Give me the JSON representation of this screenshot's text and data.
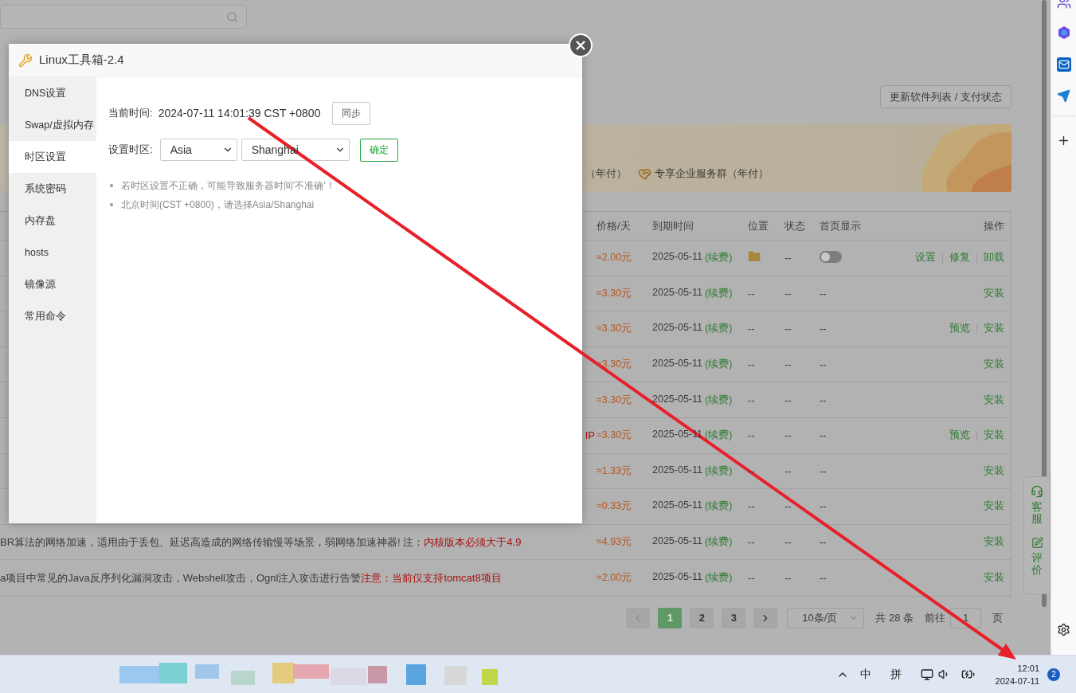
{
  "dialog": {
    "title": "Linux工具箱-2.4",
    "menu": [
      {
        "label": "DNS设置",
        "selected": false
      },
      {
        "label": "Swap/虚拟内存",
        "selected": false
      },
      {
        "label": "时区设置",
        "selected": true
      },
      {
        "label": "系统密码",
        "selected": false
      },
      {
        "label": "内存盘",
        "selected": false
      },
      {
        "label": "hosts",
        "selected": false
      },
      {
        "label": "镜像源",
        "selected": false
      },
      {
        "label": "常用命令",
        "selected": false
      }
    ],
    "time_label": "当前时间:",
    "time_value": "2024-07-11 14:01:39 CST +0800",
    "sync_button": "同步",
    "zone_label": "设置时区:",
    "region": "Asia",
    "city": "Shanghai",
    "confirm_button": "确定",
    "notes": [
      "若时区设置不正确，可能导致服务器时间'不准确'！",
      "北京时间(CST +0800)，请选择Asia/Shanghai"
    ]
  },
  "refresh_button": "更新软件列表 / 支付状态",
  "banner": {
    "items": [
      "（年付）",
      "专享企业服务群（年付）"
    ]
  },
  "table": {
    "columns": [
      "价格/天",
      "到期时间",
      "位置",
      "状态",
      "首页显示",
      "操作"
    ],
    "rows": [
      {
        "price": "≈2.00元",
        "expiry": "2025-05-11",
        "renew": "(续费)",
        "location": {
          "kind": "folder"
        },
        "status": "--",
        "homepage": {
          "kind": "toggle",
          "on": false
        },
        "actions": [
          "设置",
          "修复",
          "卸载"
        ]
      },
      {
        "price": "≈3.30元",
        "expiry": "2025-05-11",
        "renew": "(续费)",
        "location": {
          "kind": "text",
          "text": "--"
        },
        "status": "--",
        "homepage": {
          "kind": "text",
          "text": "--"
        },
        "actions": [
          "安装"
        ]
      },
      {
        "price": "≈3.30元",
        "expiry": "2025-05-11",
        "renew": "(续费)",
        "location": {
          "kind": "text",
          "text": "--"
        },
        "status": "--",
        "homepage": {
          "kind": "text",
          "text": "--"
        },
        "actions": [
          "预览",
          "安装"
        ]
      },
      {
        "price": "≈3.30元",
        "expiry": "2025-05-11",
        "renew": "(续费)",
        "location": {
          "kind": "text",
          "text": "--"
        },
        "status": "--",
        "homepage": {
          "kind": "text",
          "text": "--"
        },
        "actions": [
          "安装"
        ]
      },
      {
        "price": "≈3.30元",
        "expiry": "2025-05-11",
        "renew": "(续费)",
        "location": {
          "kind": "text",
          "text": "--"
        },
        "status": "--",
        "homepage": {
          "kind": "text",
          "text": "--"
        },
        "actions": [
          "安装"
        ]
      },
      {
        "description": {
          "warning": "IP"
        },
        "price": "≈3.30元",
        "expiry": "2025-05-11",
        "renew": "(续费)",
        "location": {
          "kind": "text",
          "text": "--"
        },
        "status": "--",
        "homepage": {
          "kind": "text",
          "text": "--"
        },
        "actions": [
          "预览",
          "安装"
        ]
      },
      {
        "price": "≈1.33元",
        "expiry": "2025-05-11",
        "renew": "(续费)",
        "location": {
          "kind": "text",
          "text": "--"
        },
        "status": "--",
        "homepage": {
          "kind": "text",
          "text": "--"
        },
        "actions": [
          "安装"
        ]
      },
      {
        "price": "≈0.33元",
        "expiry": "2025-05-11",
        "renew": "(续费)",
        "location": {
          "kind": "text",
          "text": "--"
        },
        "status": "--",
        "homepage": {
          "kind": "text",
          "text": "--"
        },
        "actions": [
          "安装"
        ]
      },
      {
        "description": {
          "text": "BR算法的网络加速，适用由于丢包、延迟高造成的网络传输慢等场景，弱网络加速神器! 注：",
          "warning": "内核版本必须大于4.9"
        },
        "price": "≈4.93元",
        "expiry": "2025-05-11",
        "renew": "(续费)",
        "location": {
          "kind": "text",
          "text": "--"
        },
        "status": "--",
        "homepage": {
          "kind": "text",
          "text": "--"
        },
        "actions": [
          "安装"
        ]
      },
      {
        "description": {
          "text": "a项目中常见的Java反序列化漏洞攻击，Webshell攻击，Ognl注入攻击进行告警",
          "warning": "注意：当前仅支持tomcat8项目"
        },
        "price": "≈2.00元",
        "expiry": "2025-05-11",
        "renew": "(续费)",
        "location": {
          "kind": "text",
          "text": "--"
        },
        "status": "--",
        "homepage": {
          "kind": "text",
          "text": "--"
        },
        "actions": [
          "安装"
        ]
      }
    ]
  },
  "pagination": {
    "pages": [
      {
        "label": "1",
        "selected": true
      },
      {
        "label": "2",
        "selected": false
      },
      {
        "label": "3",
        "selected": false
      }
    ],
    "page_size": "10条/页",
    "total": "共 28 条",
    "goto_label": "前往",
    "goto_value": "1",
    "page_unit": "页"
  },
  "float_widget": [
    "客服",
    "评价"
  ],
  "taskbar": {
    "ime_mode": "中",
    "ime": "拼",
    "time": "12:01",
    "date": "2024-07-11",
    "notifications": "2"
  }
}
